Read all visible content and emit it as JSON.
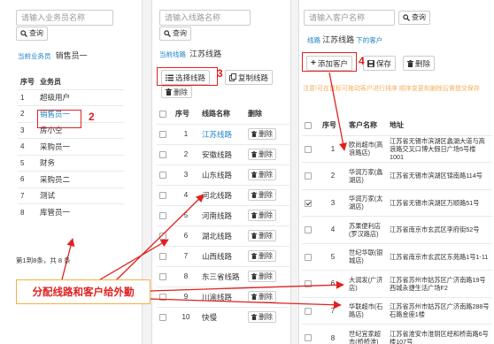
{
  "p1": {
    "search_placeholder": "请输入业务员名称",
    "query_label": "查询",
    "current_prefix": "当前业务员",
    "current_name": "销售员一",
    "headers": [
      "序号",
      "业务员"
    ],
    "rows": [
      [
        "1",
        "超级用户"
      ],
      [
        "2",
        "销售员一"
      ],
      [
        "3",
        "房小空"
      ],
      [
        "4",
        "采购员一"
      ],
      [
        "5",
        "财务"
      ],
      [
        "6",
        "采购员二"
      ],
      [
        "7",
        "测试"
      ],
      [
        "8",
        "库管员一"
      ]
    ],
    "footer": "第1到8条，共 8 条"
  },
  "p2": {
    "search_placeholder": "请输入线路名称",
    "query_label": "查询",
    "current_prefix": "当前线路",
    "current_name": "江苏线路",
    "select_label": "选择线路",
    "copy_label": "复制线路",
    "delete_label": "删除",
    "headers": [
      "序号",
      "线路名称",
      "删除"
    ],
    "row_delete_label": "删除",
    "rows": [
      [
        "1",
        "江苏线路"
      ],
      [
        "2",
        "安徽线路"
      ],
      [
        "3",
        "山东线路"
      ],
      [
        "4",
        "河北线路"
      ],
      [
        "5",
        "河南线路"
      ],
      [
        "6",
        "湖北线路"
      ],
      [
        "7",
        "山西线路"
      ],
      [
        "8",
        "东三省线路"
      ],
      [
        "9",
        "川渝线路"
      ],
      [
        "10",
        "快慢"
      ]
    ]
  },
  "p3": {
    "search_placeholder": "请输入客户名称",
    "query_label": "查询",
    "breadcrumb_prefix": "线路",
    "breadcrumb_name": "江苏线路",
    "breadcrumb_suffix": "下的客户",
    "add_label": "添加客户",
    "save_label": "保存",
    "delete_label": "删除",
    "notice": "注意!可在鼠标可拖动客户进行排序 顺序变更和删除后需提交保存",
    "headers": [
      "序号",
      "客户名称",
      "地址"
    ],
    "rows": [
      {
        "no": "1",
        "name": "欧尚超市(高浪路店)",
        "addr": "江苏省无锡市滨湖区蠡湖大道与高浪路交叉口博大假日广场5号楼1001",
        "checked": false
      },
      {
        "no": "2",
        "name": "华润万家(蠡湖店)",
        "addr": "江苏省无锡市滨湖区锦南路114号",
        "checked": false
      },
      {
        "no": "3",
        "name": "华润万家(太湖店)",
        "addr": "江苏省无锡市滨湖区万顺路51号",
        "checked": true
      },
      {
        "no": "4",
        "name": "苏果便利店(罗汉路店)",
        "addr": "江苏省南京市玄武区李府街52号",
        "checked": false
      },
      {
        "no": "5",
        "name": "世纪华联(银城店)",
        "addr": "江苏省南京市玄武区东苑路1号1-11",
        "checked": false
      },
      {
        "no": "6",
        "name": "大润发(广济店)",
        "addr": "江苏省苏州市姑苏区广济南路19号西城永捷生活广场F2",
        "checked": false
      },
      {
        "no": "7",
        "name": "华联超市(石路店)",
        "addr": "江苏省苏州市姑苏区广济南路288号石路金座1楼",
        "checked": false
      },
      {
        "no": "8",
        "name": "世纪宜家超市(桥桥淮)",
        "addr": "江苏省淮安市淮阴区经和桥南路6号楼107号",
        "checked": false
      }
    ]
  },
  "annotations": {
    "n2": "2",
    "n3": "3",
    "n4": "4",
    "callout": "分配线路和客户给外勤"
  },
  "colors": {
    "link": "#1c84c6",
    "red": "#e02020",
    "callout_border": "#f5b041",
    "notice": "#f8ac59"
  }
}
